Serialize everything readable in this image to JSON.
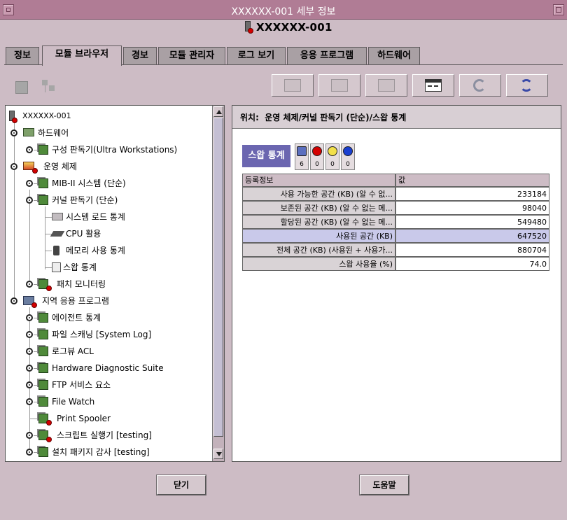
{
  "window": {
    "title": "XXXXXX-001 세부 정보",
    "host_label": "XXXXXX-001"
  },
  "tabs": [
    {
      "label": "정보",
      "active": false
    },
    {
      "label": "모듈 브라우저",
      "active": true
    },
    {
      "label": "경보",
      "active": false
    },
    {
      "label": "모듈 관리자",
      "active": false
    },
    {
      "label": "로그 보기",
      "active": false
    },
    {
      "label": "응용 프로그램",
      "active": false
    },
    {
      "label": "하드웨어",
      "active": false
    }
  ],
  "toolbar": {
    "left_icons": [
      "module-view-icon",
      "tree-view-icon"
    ],
    "right_icons": [
      "edit-icon",
      "graph-icon",
      "chart-icon",
      "properties-icon",
      "refresh-icon",
      "sync-icon"
    ]
  },
  "tree": {
    "root": "XXXXXX-001",
    "items": [
      {
        "label": "하드웨어",
        "icon": "hardware-icon",
        "alert": false
      },
      {
        "label": "구성 판독기(Ultra Workstations)",
        "icon": "module-icon",
        "alert": false
      },
      {
        "label": "운영 체제",
        "icon": "os-icon",
        "alert": true
      },
      {
        "label": "MIB-II 시스템 (단순)",
        "icon": "module-icon",
        "alert": false
      },
      {
        "label": "커널 판독기 (단순)",
        "icon": "module-icon",
        "alert": false
      },
      {
        "label": "시스템 로드 통계",
        "icon": "load-icon",
        "alert": false
      },
      {
        "label": "CPU 활용",
        "icon": "cpu-icon",
        "alert": false
      },
      {
        "label": "메모리 사용 통계",
        "icon": "memory-icon",
        "alert": false
      },
      {
        "label": "스왑 통계",
        "icon": "swap-icon",
        "alert": false
      },
      {
        "label": "패치 모니터링",
        "icon": "module-icon",
        "alert": true
      },
      {
        "label": "지역 응용 프로그램",
        "icon": "apps-icon",
        "alert": true
      },
      {
        "label": "에이전트 통계",
        "icon": "module-icon",
        "alert": false
      },
      {
        "label": "파일 스캐닝 [System Log]",
        "icon": "module-icon",
        "alert": false
      },
      {
        "label": "로그뷰 ACL",
        "icon": "module-icon",
        "alert": false
      },
      {
        "label": "Hardware Diagnostic Suite",
        "icon": "module-icon",
        "alert": false
      },
      {
        "label": "FTP 서비스 요소",
        "icon": "module-icon",
        "alert": false
      },
      {
        "label": "File Watch",
        "icon": "module-icon",
        "alert": false
      },
      {
        "label": "Print Spooler",
        "icon": "module-icon",
        "alert": true
      },
      {
        "label": "스크립트 실행기 [testing]",
        "icon": "module-icon",
        "alert": true
      },
      {
        "label": "설치 패키지 감사 [testing]",
        "icon": "module-icon",
        "alert": false
      }
    ]
  },
  "location": {
    "label": "위치:",
    "path": "운영 체제/커널 판독기 (단순)/스왑 통계"
  },
  "panel": {
    "title": "스왑 통계",
    "alarms": [
      {
        "name": "info-alarm",
        "count": "6",
        "color": "#5b6fbf"
      },
      {
        "name": "critical-alarm",
        "count": "0",
        "color": "#d40000"
      },
      {
        "name": "warning-alarm",
        "count": "0",
        "color": "#f2e04a"
      },
      {
        "name": "down-alarm",
        "count": "0",
        "color": "#1a3fd0"
      }
    ]
  },
  "table": {
    "headers": [
      "등록정보",
      "값"
    ],
    "rows": [
      {
        "property": "사용 가능한 공간 (KB) (알 수 없...",
        "value": "233184",
        "selected": false
      },
      {
        "property": "보존된 공간 (KB) (알 수 없는 메...",
        "value": "98040",
        "selected": false
      },
      {
        "property": "할당된 공간 (KB) (알 수 없는 메...",
        "value": "549480",
        "selected": false
      },
      {
        "property": "사용된 공간 (KB)",
        "value": "647520",
        "selected": true
      },
      {
        "property": "전체 공간 (KB) (사용된 + 사용가...",
        "value": "880704",
        "selected": false
      },
      {
        "property": "스왑 사용율 (%)",
        "value": "74.0",
        "selected": false
      }
    ]
  },
  "buttons": {
    "close": "닫기",
    "help": "도움말"
  }
}
